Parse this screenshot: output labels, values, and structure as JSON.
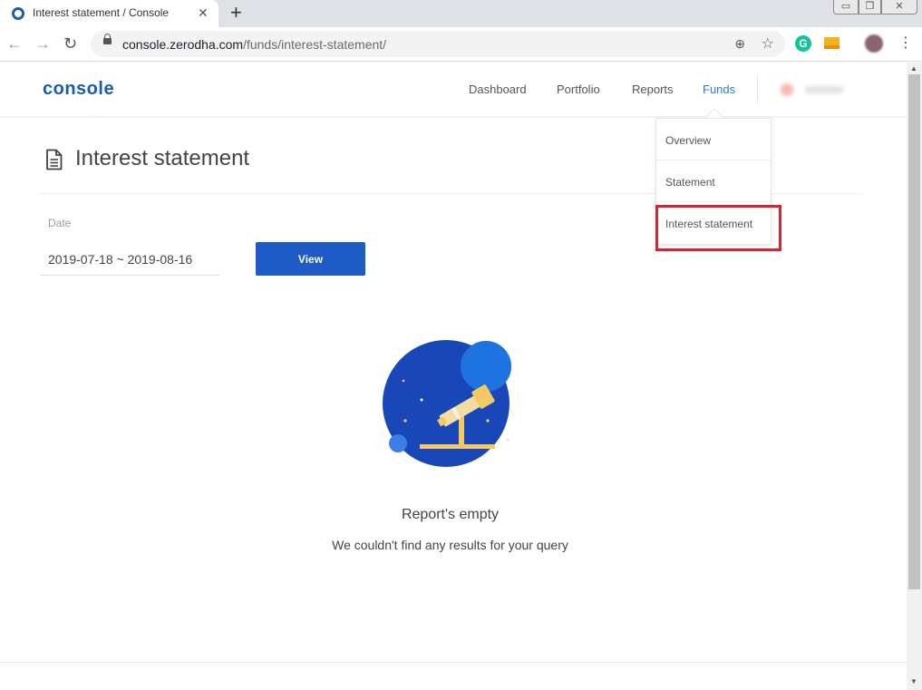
{
  "browser": {
    "tab_title": "Interest statement / Console",
    "tab_close": "✕",
    "new_tab": "+",
    "url_host": "console.zerodha.com",
    "url_path": "/funds/interest-statement/",
    "extension_grammarly": "G"
  },
  "app": {
    "logo": "console",
    "nav": {
      "dashboard": "Dashboard",
      "portfolio": "Portfolio",
      "reports": "Reports",
      "funds": "Funds"
    },
    "funds_menu": {
      "items": [
        {
          "label": "Overview"
        },
        {
          "label": "Statement"
        },
        {
          "label": "Interest statement"
        }
      ]
    }
  },
  "main": {
    "page_title": "Interest statement",
    "date_label": "Date",
    "date_value": "2019-07-18 ~ 2019-08-16",
    "view_button": "View",
    "empty_title": "Report's empty",
    "empty_subtitle": "We couldn't find any results for your query"
  },
  "colors": {
    "brand_blue": "#1a5cb0",
    "button_blue": "#1e5bc6",
    "active_nav": "#2a7fd4",
    "highlight_red": "#d32630"
  }
}
